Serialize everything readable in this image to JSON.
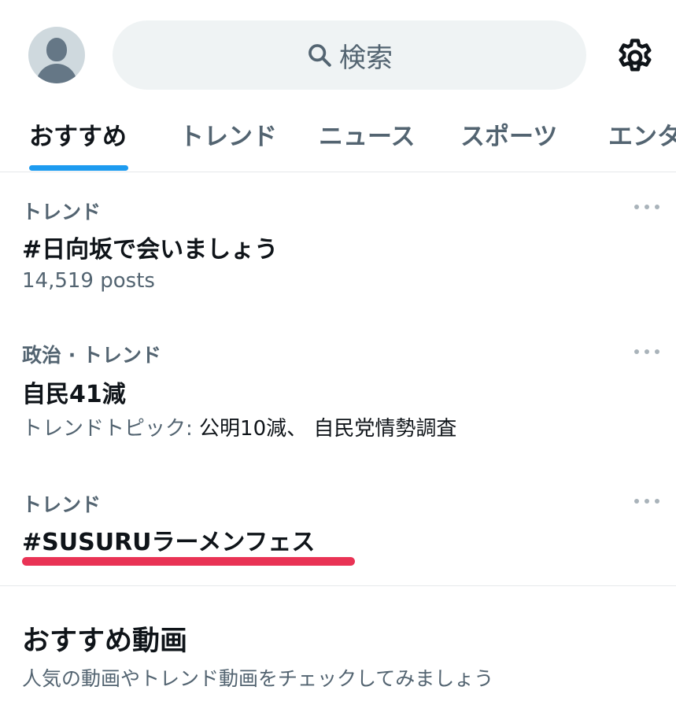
{
  "header": {
    "search_placeholder": "検索",
    "icons": [
      "avatar",
      "search-icon",
      "gear-icon"
    ]
  },
  "tabs": [
    {
      "label": "おすすめ",
      "active": true
    },
    {
      "label": "トレンド",
      "active": false
    },
    {
      "label": "ニュース",
      "active": false
    },
    {
      "label": "スポーツ",
      "active": false
    },
    {
      "label": "エンタ",
      "active": false
    }
  ],
  "trends": [
    {
      "meta": "トレンド",
      "title": "#日向坂で会いましょう",
      "sub": "14,519 posts"
    },
    {
      "meta": "政治 · トレンド",
      "title": "自民41減",
      "sub_prefix": "トレンドトピック: ",
      "sub_highlight": "公明10減、 自民党情勢調査"
    },
    {
      "meta": "トレンド",
      "title": "#SUSURUラーメンフェス"
    }
  ],
  "recommended": {
    "title": "おすすめ動画",
    "subtitle": "人気の動画やトレンド動画をチェックしてみましょう"
  },
  "colors": {
    "accent": "#1d9bf0",
    "highlight_underline": "#e93355",
    "secondary_text": "#536471"
  }
}
